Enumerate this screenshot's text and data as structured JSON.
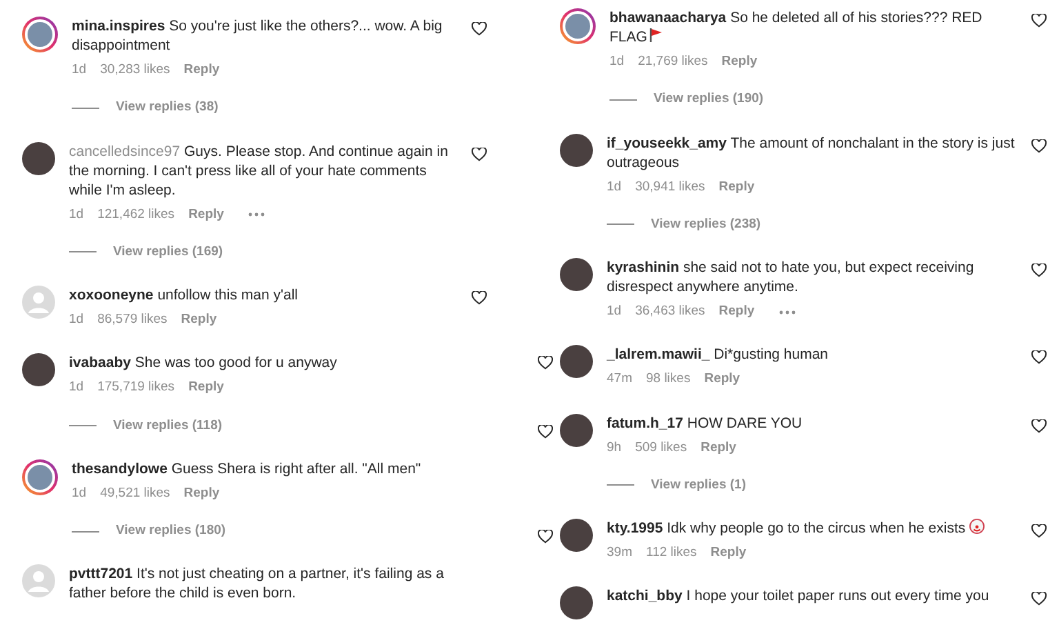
{
  "columns": [
    {
      "comments": [
        {
          "avatar": {
            "kind": "ring"
          },
          "username": "mina.inspires",
          "username_muted": false,
          "text": "So you're just like the others?... wow. A big disappointment",
          "time": "1d",
          "likes": "30,283 likes",
          "reply": "Reply",
          "more": false,
          "view_replies": "View replies (38)",
          "heart": true,
          "edge_heart": false
        },
        {
          "avatar": {
            "kind": "photo"
          },
          "username": "cancelledsince97",
          "username_muted": true,
          "text": "Guys. Please stop. And continue again in the morning. I can't press like all of your hate comments while I'm asleep.",
          "time": "1d",
          "likes": "121,462 likes",
          "reply": "Reply",
          "more": true,
          "view_replies": "View replies (169)",
          "heart": true,
          "edge_heart": false
        },
        {
          "avatar": {
            "kind": "default"
          },
          "username": "xoxooneyne",
          "username_muted": false,
          "text": "unfollow this man y'all",
          "time": "1d",
          "likes": "86,579 likes",
          "reply": "Reply",
          "more": false,
          "heart": true,
          "edge_heart": false
        },
        {
          "avatar": {
            "kind": "photo"
          },
          "username": "ivabaaby",
          "username_muted": false,
          "text": "She was too good for u anyway",
          "time": "1d",
          "likes": "175,719 likes",
          "reply": "Reply",
          "more": false,
          "view_replies": "View replies (118)",
          "heart": false,
          "edge_heart": false
        },
        {
          "avatar": {
            "kind": "ring"
          },
          "username": "thesandylowe",
          "username_muted": false,
          "text": "Guess Shera is right after all. \"All men\"",
          "time": "1d",
          "likes": "49,521 likes",
          "reply": "Reply",
          "more": false,
          "view_replies": "View replies (180)",
          "heart": false,
          "edge_heart": false
        },
        {
          "avatar": {
            "kind": "default"
          },
          "username": "pvttt7201",
          "username_muted": false,
          "text": "It's not just cheating on a partner, it's failing as a father before the child is even born.",
          "heart": false,
          "edge_heart": false
        }
      ]
    },
    {
      "comments": [
        {
          "avatar": {
            "kind": "ring"
          },
          "username": "bhawanaacharya",
          "username_muted": false,
          "text": "So he deleted all of his stories??? RED FLAG",
          "trailing_icon": {
            "kind": "flag"
          },
          "time": "1d",
          "likes": "21,769 likes",
          "reply": "Reply",
          "more": false,
          "view_replies": "View replies (190)",
          "heart": true,
          "edge_heart": false
        },
        {
          "avatar": {
            "kind": "photo"
          },
          "username": "if_youseekk_amy",
          "username_muted": false,
          "text": "The amount of nonchalant in the story is just outrageous",
          "time": "1d",
          "likes": "30,941 likes",
          "reply": "Reply",
          "more": false,
          "view_replies": "View replies (238)",
          "heart": true,
          "edge_heart": false
        },
        {
          "avatar": {
            "kind": "photo"
          },
          "username": "kyrashinin",
          "username_muted": false,
          "text": "she said not to hate you, but expect receiving disrespect anywhere anytime.",
          "time": "1d",
          "likes": "36,463 likes",
          "reply": "Reply",
          "more": true,
          "heart": true,
          "edge_heart": false
        },
        {
          "avatar": {
            "kind": "photo"
          },
          "username": "_lalrem.mawii_",
          "username_muted": false,
          "text": "Di*gusting human",
          "time": "47m",
          "likes": "98 likes",
          "reply": "Reply",
          "more": false,
          "heart": true,
          "edge_heart": true
        },
        {
          "avatar": {
            "kind": "photo"
          },
          "username": "fatum.h_17",
          "username_muted": false,
          "text": "HOW DARE YOU",
          "time": "9h",
          "likes": "509 likes",
          "reply": "Reply",
          "more": false,
          "view_replies": "View replies (1)",
          "heart": true,
          "edge_heart": true
        },
        {
          "avatar": {
            "kind": "photo"
          },
          "username": "kty.1995",
          "username_muted": false,
          "text": "Idk why people go to the circus when he exists",
          "trailing_icon": {
            "kind": "clown"
          },
          "time": "39m",
          "likes": "112 likes",
          "reply": "Reply",
          "more": false,
          "heart": true,
          "edge_heart": true
        },
        {
          "avatar": {
            "kind": "photo"
          },
          "username": "katchi_bby",
          "username_muted": false,
          "text": "I hope your toilet paper runs out every time you",
          "heart": true,
          "edge_heart": false
        }
      ]
    }
  ]
}
